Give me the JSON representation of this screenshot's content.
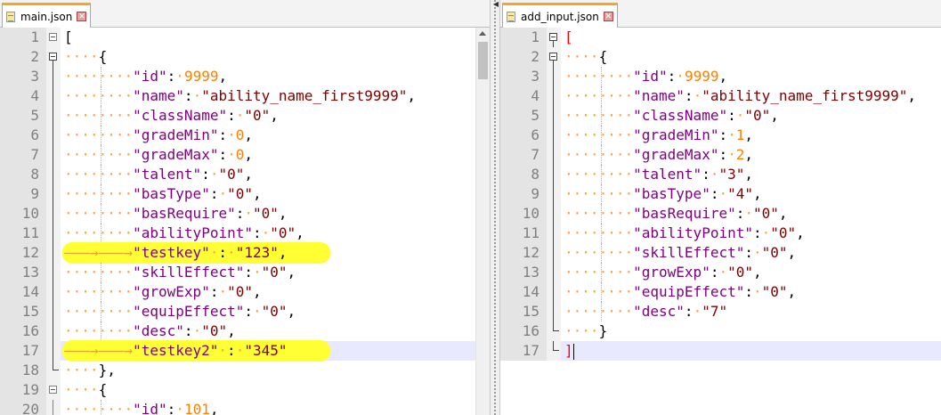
{
  "left": {
    "tab_label": "main.json",
    "close_glyph": "✕",
    "lines": [
      {
        "n": "1",
        "t": "["
      },
      {
        "n": "2",
        "t": "    {"
      },
      {
        "n": "3",
        "t": "        \"id\": 9999,"
      },
      {
        "n": "4",
        "t": "        \"name\": \"ability_name_first9999\","
      },
      {
        "n": "5",
        "t": "        \"className\": \"0\","
      },
      {
        "n": "6",
        "t": "        \"gradeMin\": 0,"
      },
      {
        "n": "7",
        "t": "        \"gradeMax\": 0,"
      },
      {
        "n": "8",
        "t": "        \"talent\": \"0\","
      },
      {
        "n": "9",
        "t": "        \"basType\": \"0\","
      },
      {
        "n": "10",
        "t": "        \"basRequire\": \"0\","
      },
      {
        "n": "11",
        "t": "        \"abilityPoint\": \"0\","
      },
      {
        "n": "12",
        "t": "\t\t\"testkey\" : \"123\",",
        "highlight": true
      },
      {
        "n": "13",
        "t": "        \"skillEffect\": \"0\","
      },
      {
        "n": "14",
        "t": "        \"growExp\": \"0\","
      },
      {
        "n": "15",
        "t": "        \"equipEffect\": \"0\","
      },
      {
        "n": "16",
        "t": "        \"desc\": \"0\","
      },
      {
        "n": "17",
        "t": "\t\t\"testkey2\" : \"345\"",
        "highlight": true,
        "current": true
      },
      {
        "n": "18",
        "t": "    },"
      },
      {
        "n": "19",
        "t": "    {"
      },
      {
        "n": "20",
        "t": "        \"id\": 101,"
      }
    ]
  },
  "right": {
    "tab_label": "add_input.json",
    "close_glyph": "✕",
    "lines": [
      {
        "n": "1",
        "t": "["
      },
      {
        "n": "2",
        "t": "    {"
      },
      {
        "n": "3",
        "t": "        \"id\": 9999,"
      },
      {
        "n": "4",
        "t": "        \"name\": \"ability_name_first9999\","
      },
      {
        "n": "5",
        "t": "        \"className\": \"0\","
      },
      {
        "n": "6",
        "t": "        \"gradeMin\": 1,"
      },
      {
        "n": "7",
        "t": "        \"gradeMax\": 2,"
      },
      {
        "n": "8",
        "t": "        \"talent\": \"3\","
      },
      {
        "n": "9",
        "t": "        \"basType\": \"4\","
      },
      {
        "n": "10",
        "t": "        \"basRequire\": \"0\","
      },
      {
        "n": "11",
        "t": "        \"abilityPoint\": \"0\","
      },
      {
        "n": "12",
        "t": "        \"skillEffect\": \"0\","
      },
      {
        "n": "13",
        "t": "        \"growExp\": \"0\","
      },
      {
        "n": "14",
        "t": "        \"equipEffect\": \"0\","
      },
      {
        "n": "15",
        "t": "        \"desc\": \"7\""
      },
      {
        "n": "16",
        "t": "    }"
      },
      {
        "n": "17",
        "t": "]",
        "current": true
      }
    ]
  },
  "colors": {
    "key": "#800080",
    "string": "#800000",
    "number": "#ff8000",
    "whitespace": "#f3a24a",
    "highlight": "#ffff33",
    "current_line": "#e8e8ff",
    "tab_accent": "#f5a623"
  },
  "icons": {
    "tab_file": "json-file-icon",
    "tab_close": "close-icon",
    "fold": "fold-minus-icon",
    "splitter_arrow": "collapse-arrow-icon"
  }
}
